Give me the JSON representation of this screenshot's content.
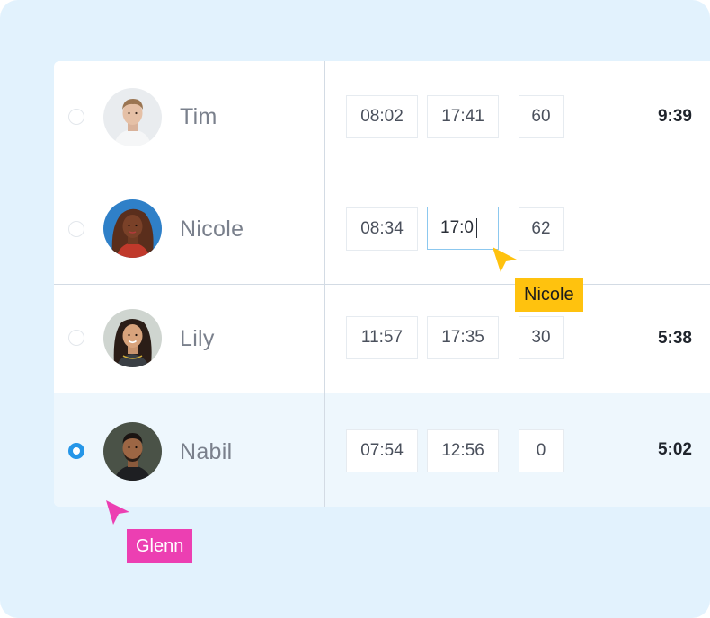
{
  "rows": [
    {
      "name": "Tim",
      "start": "08:02",
      "end": "17:41",
      "break": "60",
      "total": "9:39",
      "selected": false,
      "avatar": "tim-avatar-photo"
    },
    {
      "name": "Nicole",
      "start": "08:34",
      "end": "17:0",
      "break": "62",
      "total": "",
      "selected": false,
      "avatar": "nicole-avatar-photo",
      "editing": true
    },
    {
      "name": "Lily",
      "start": "11:57",
      "end": "17:35",
      "break": "30",
      "total": "5:38",
      "selected": false,
      "avatar": "lily-avatar-photo"
    },
    {
      "name": "Nabil",
      "start": "07:54",
      "end": "12:56",
      "break": "0",
      "total": "5:02",
      "selected": true,
      "avatar": "nabil-avatar-photo"
    }
  ],
  "cursors": [
    {
      "label": "Nicole",
      "color": "#ffc20e",
      "icon": "cursor-arrow-icon"
    },
    {
      "label": "Glenn",
      "color": "#ec3fb2",
      "icon": "cursor-arrow-icon"
    }
  ],
  "colors": {
    "background": "#e2f2fd",
    "selected_row": "#eef7fd",
    "accent": "#2596e8",
    "active_cell_border": "#8cc8ef"
  }
}
